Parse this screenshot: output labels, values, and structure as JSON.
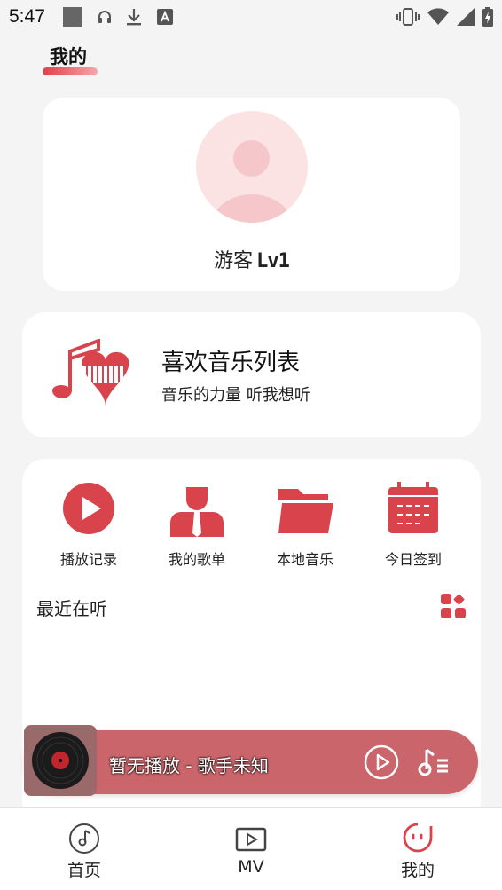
{
  "status_bar": {
    "time": "5:47",
    "icons": [
      "photo-icon",
      "headphones-icon",
      "download-icon",
      "a-badge-icon",
      "vibrate-icon",
      "wifi-icon",
      "signal-icon",
      "battery-icon"
    ]
  },
  "header": {
    "title": "我的"
  },
  "profile": {
    "name": "游客",
    "level": "Lv1"
  },
  "favorite": {
    "title": "喜欢音乐列表",
    "subtitle": "音乐的力量 听我想听"
  },
  "features": [
    {
      "label": "播放记录",
      "icon": "play-circle-icon"
    },
    {
      "label": "我的歌单",
      "icon": "user-tie-icon"
    },
    {
      "label": "本地音乐",
      "icon": "folder-icon"
    },
    {
      "label": "今日签到",
      "icon": "calendar-icon"
    }
  ],
  "recent": {
    "title": "最近在听"
  },
  "player": {
    "song": "暂无播放 - 歌手未知"
  },
  "bottom_nav": [
    {
      "label": "首页",
      "icon": "music-note-icon"
    },
    {
      "label": "MV",
      "icon": "video-play-icon"
    },
    {
      "label": "我的",
      "icon": "smiley-icon"
    }
  ],
  "colors": {
    "accent": "#e0404a",
    "player_bg": "#c9656b",
    "background": "#f4f4f4"
  }
}
